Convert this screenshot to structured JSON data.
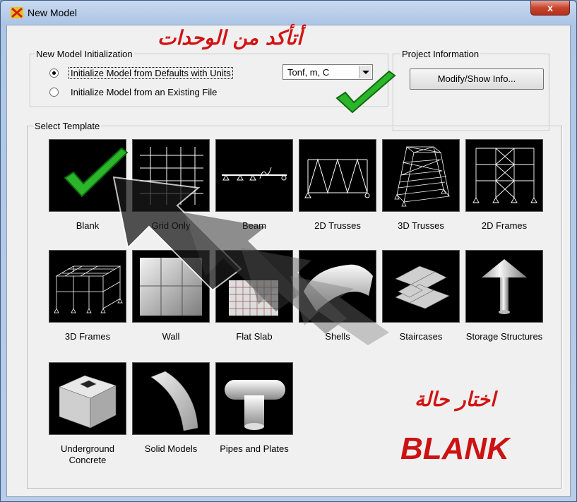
{
  "window": {
    "title": "New Model",
    "close_label": "x",
    "app_icon": "app-icon"
  },
  "init": {
    "legend": "New Model Initialization",
    "option_defaults": "Initialize Model from Defaults with Units",
    "option_existing": "Initialize Model  from an Existing File",
    "units_selected": "Tonf, m, C"
  },
  "project": {
    "legend": "Project Information",
    "button_label": "Modify/Show Info..."
  },
  "templates": {
    "legend": "Select Template",
    "items": [
      {
        "label": "Blank",
        "icon": "blank-template-icon"
      },
      {
        "label": "Grid Only",
        "icon": "grid-template-icon"
      },
      {
        "label": "Beam",
        "icon": "beam-template-icon"
      },
      {
        "label": "2D Trusses",
        "icon": "2d-truss-icon"
      },
      {
        "label": "3D Trusses",
        "icon": "3d-truss-icon"
      },
      {
        "label": "2D Frames",
        "icon": "2d-frame-icon"
      },
      {
        "label": "3D Frames",
        "icon": "3d-frame-icon"
      },
      {
        "label": "Wall",
        "icon": "wall-icon"
      },
      {
        "label": "Flat Slab",
        "icon": "flat-slab-icon"
      },
      {
        "label": "Shells",
        "icon": "shell-icon"
      },
      {
        "label": "Staircases",
        "icon": "staircase-icon"
      },
      {
        "label": "Storage Structures",
        "icon": "storage-structure-icon"
      },
      {
        "label": "Underground Concrete",
        "icon": "underground-concrete-icon"
      },
      {
        "label": "Solid Models",
        "icon": "solid-model-icon"
      },
      {
        "label": "Pipes and Plates",
        "icon": "pipes-plates-icon"
      }
    ]
  },
  "annotations": {
    "check_units_ar": "أتأكد من الوحدات",
    "choose_case_ar": "اختار حالة",
    "blank_en": "BLANK",
    "accent_red": "#d01414",
    "check_green": "#2bb52b"
  }
}
